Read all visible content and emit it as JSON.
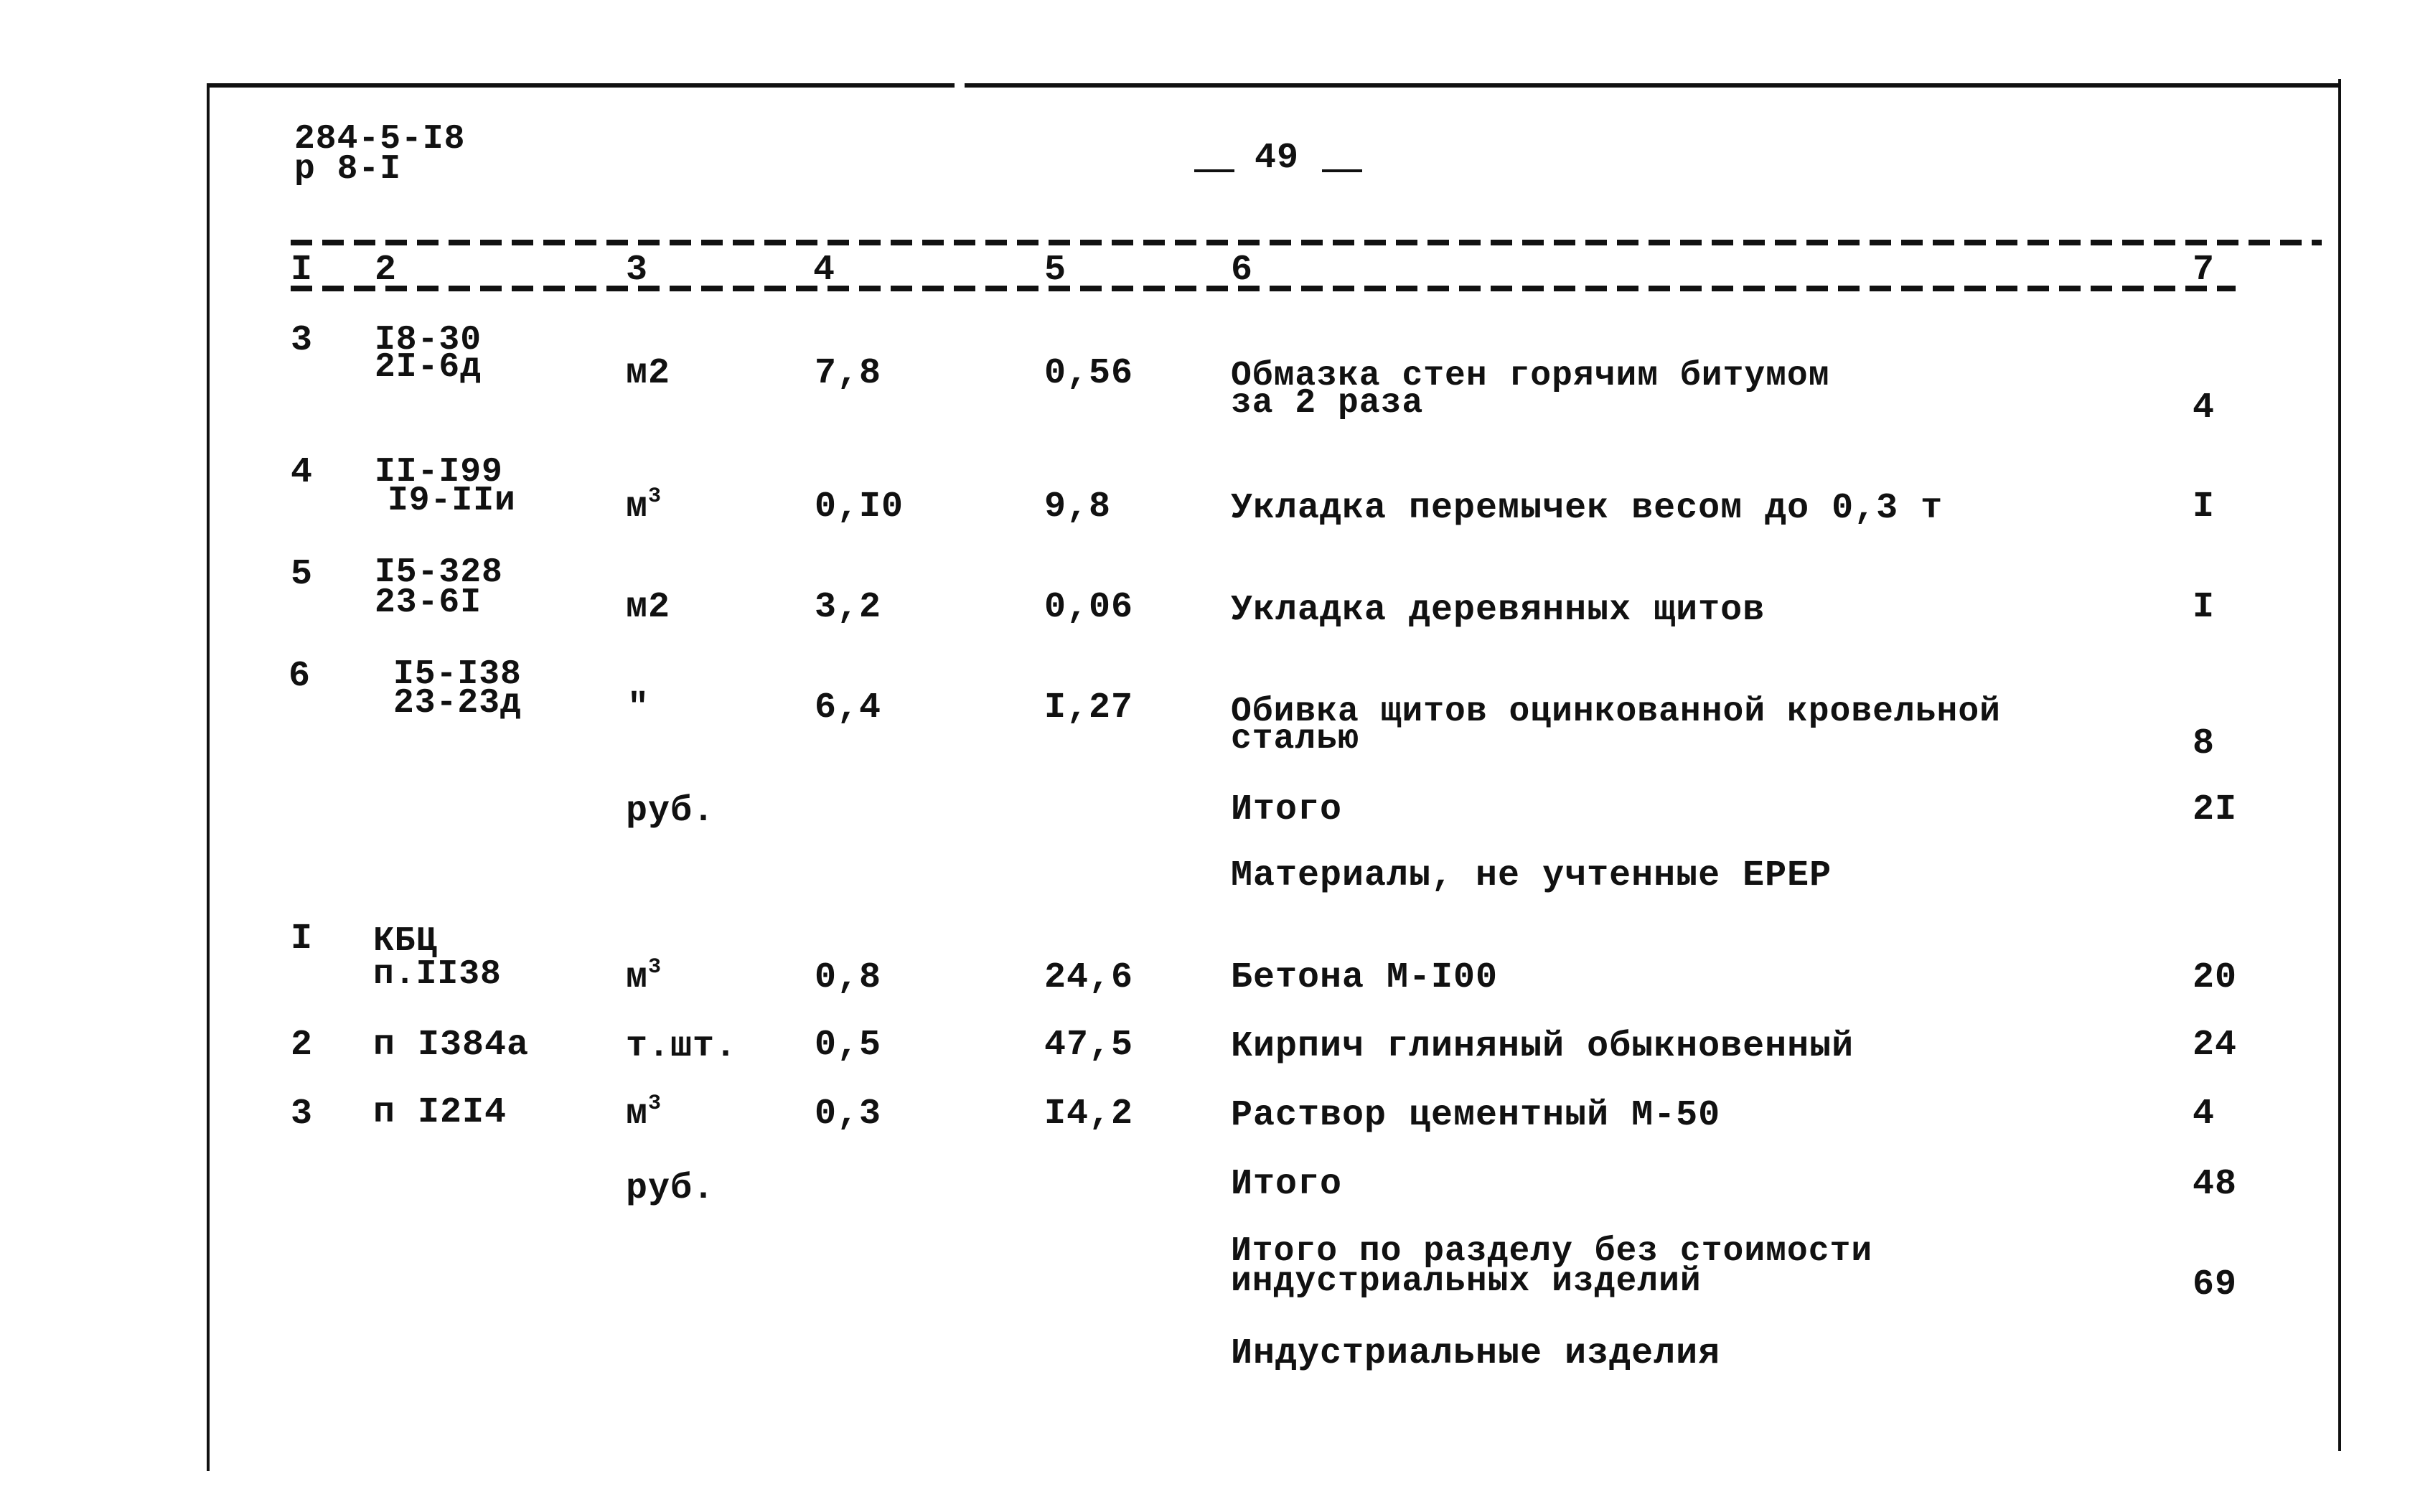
{
  "header": {
    "doc_code_line1": "284-5-I8",
    "doc_code_line2": "р 8-I",
    "page_number": "49"
  },
  "column_numbers": [
    "I",
    "2",
    "3",
    "4",
    "5",
    "6",
    "7"
  ],
  "work_rows": [
    {
      "no": "3",
      "code_line1": "I8-30",
      "code_line2": "2I-6д",
      "unit": "м2",
      "unit_sup": "",
      "qty": "7,8",
      "price": "0,56",
      "desc_line1": "Обмазка стен горячим битумом",
      "desc_line2": "за 2 раза",
      "total": "4"
    },
    {
      "no": "4",
      "code_line1": "II-I99",
      "code_line2": "I9-IIи",
      "unit": "м",
      "unit_sup": "3",
      "qty": "0,I0",
      "price": "9,8",
      "desc_line1": "Укладка перемычек весом до 0,3 т",
      "desc_line2": "",
      "total": "I"
    },
    {
      "no": "5",
      "code_line1": "I5-328",
      "code_line2": "23-6I",
      "unit": "м2",
      "unit_sup": "",
      "qty": "3,2",
      "price": "0,06",
      "desc_line1": "Укладка деревянных щитов",
      "desc_line2": "",
      "total": "I"
    },
    {
      "no": "6",
      "code_line1": "I5-I38",
      "code_line2": "23-23д",
      "unit": "\"",
      "unit_sup": "",
      "qty": "6,4",
      "price": "I,27",
      "desc_line1": "Обивка щитов оцинкованной кровельной",
      "desc_line2": "сталью",
      "total": "8"
    }
  ],
  "work_total": {
    "unit": "руб.",
    "label": "Итого",
    "total": "2I"
  },
  "materials_heading": "Материалы, не учтенные ЕРЕР",
  "material_rows": [
    {
      "no": "I",
      "code_line1": "КБЦ",
      "code_line2": "п.II38",
      "unit": "м",
      "unit_sup": "3",
      "qty": "0,8",
      "price": "24,6",
      "desc": "Бетона М-I00",
      "total": "20"
    },
    {
      "no": "2",
      "code_line1": "",
      "code_line2": "п I384а",
      "unit": "т.шт.",
      "unit_sup": "",
      "qty": "0,5",
      "price": "47,5",
      "desc": "Кирпич глиняный обыкновенный",
      "total": "24"
    },
    {
      "no": "3",
      "code_line1": "",
      "code_line2": "п I2I4",
      "unit": "м",
      "unit_sup": "3",
      "qty": "0,3",
      "price": "I4,2",
      "desc": "Раствор цементный М-50",
      "total": "4"
    }
  ],
  "materials_total": {
    "unit": "руб.",
    "label": "Итого",
    "total": "48"
  },
  "section_total": {
    "label_line1": "Итого по разделу без стоимости",
    "label_line2": "индустриальных изделий",
    "total": "69"
  },
  "industrial_heading": "Индустриальные изделия"
}
